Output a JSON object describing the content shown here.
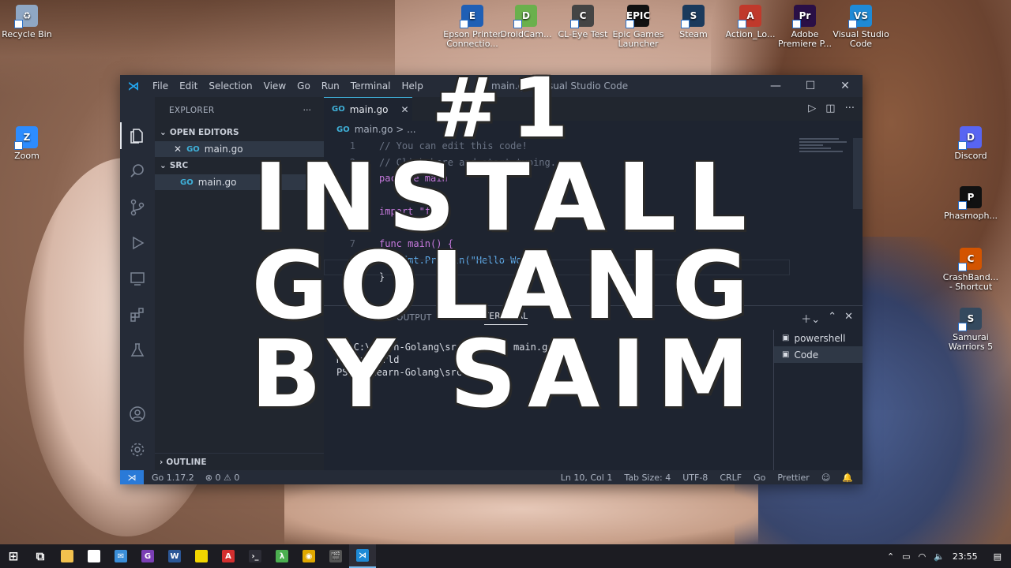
{
  "desktop": {
    "icons_top": [
      {
        "label": "Epson Printer Connectio...",
        "color": "#1f5fb5",
        "glyph": "E"
      },
      {
        "label": "DroidCam...",
        "color": "#6ab04c",
        "glyph": "D"
      },
      {
        "label": "CL-Eye Test",
        "color": "#444444",
        "glyph": "C"
      },
      {
        "label": "Epic Games Launcher",
        "color": "#111111",
        "glyph": "EPIC"
      },
      {
        "label": "Steam",
        "color": "#1b3a5c",
        "glyph": "S"
      },
      {
        "label": "Action_Lo...",
        "color": "#c0392b",
        "glyph": "A"
      },
      {
        "label": "Adobe Premiere P...",
        "color": "#2a0f46",
        "glyph": "Pr"
      },
      {
        "label": "Visual Studio Code",
        "color": "#1e8ad6",
        "glyph": "VS"
      }
    ],
    "icons_left": [
      {
        "label": "Recycle Bin",
        "color": "#8fa7c4",
        "glyph": "♻"
      },
      {
        "label": "Zoom",
        "color": "#2d8cff",
        "glyph": "Z"
      }
    ],
    "icons_right": [
      {
        "label": "Discord",
        "color": "#5865f2",
        "glyph": "D"
      },
      {
        "label": "Phasmoph...",
        "color": "#111111",
        "glyph": "P"
      },
      {
        "label": "CrashBand... - Shortcut",
        "color": "#d35400",
        "glyph": "C"
      },
      {
        "label": "Samurai Warriors 5",
        "color": "#34495e",
        "glyph": "S"
      }
    ]
  },
  "window": {
    "logo": "⋊",
    "menu": [
      "File",
      "Edit",
      "Selection",
      "View",
      "Go",
      "Run",
      "Terminal",
      "Help"
    ],
    "title": "main.go - Visual Studio Code",
    "minimize": "—",
    "maximize": "☐",
    "close": "✕"
  },
  "sidebar": {
    "header": "EXPLORER",
    "more": "···",
    "open_editors": "OPEN EDITORS",
    "open_file": "main.go",
    "folder": "SRC",
    "folder_file": "main.go",
    "outline": "OUTLINE"
  },
  "editor": {
    "tab": "main.go",
    "breadcrumb": "main.go > ...",
    "lines": [
      {
        "n": "1",
        "text": "// You can edit this code!",
        "cls": "c-com"
      },
      {
        "n": "2",
        "text": "// Click here and start typing.",
        "cls": "c-com"
      },
      {
        "n": "3",
        "text": "package main",
        "cls": "c-kw"
      },
      {
        "n": "4",
        "text": "",
        "cls": "c-id"
      },
      {
        "n": "5",
        "text": "import \"fmt\"",
        "cls": "c-kw"
      },
      {
        "n": "6",
        "text": "",
        "cls": "c-id"
      },
      {
        "n": "7",
        "text": "func main() {",
        "cls": "c-kw"
      },
      {
        "n": "8",
        "text": "    fmt.Println(\"Hello World\")",
        "cls": "c-fn"
      },
      {
        "n": "9",
        "text": "}",
        "cls": "c-id"
      },
      {
        "n": "10",
        "text": "",
        "cls": "c-id"
      }
    ]
  },
  "panel": {
    "tab_output": "OUTPUT",
    "tab_terminal": "TERMINAL",
    "terminal_lines": [
      "PS C:\\Learn-Golang\\src> go run main.go",
      "Hello World",
      "PS C:\\Learn-Golang\\src> "
    ],
    "terminals": [
      "powershell",
      "Code"
    ]
  },
  "statusbar": {
    "go_version": "Go 1.17.2",
    "problems": "⊗ 0 ⚠ 0",
    "position": "Ln 10, Col 1",
    "tab_size": "Tab Size: 4",
    "encoding": "UTF-8",
    "eol": "CRLF",
    "language": "Go",
    "prettier": "Prettier"
  },
  "overlay": {
    "line1": "#1",
    "line2": "INSTALL",
    "line3": "GOLANG",
    "line4": "BY SAIM"
  },
  "taskbar": {
    "apps": [
      {
        "name": "start",
        "color": "#ffffff",
        "glyph": "⊞"
      },
      {
        "name": "task-view",
        "color": "#ffffff",
        "glyph": "⧉"
      },
      {
        "name": "file-explorer",
        "color": "#f2c14e",
        "glyph": ""
      },
      {
        "name": "store",
        "color": "#ffffff",
        "glyph": "🛍"
      },
      {
        "name": "mail",
        "color": "#3b8ed8",
        "glyph": "✉"
      },
      {
        "name": "app-g",
        "color": "#7b3fb5",
        "glyph": "G"
      },
      {
        "name": "word",
        "color": "#2b5797",
        "glyph": "W"
      },
      {
        "name": "sticky-notes",
        "color": "#f2d600",
        "glyph": ""
      },
      {
        "name": "acrobat",
        "color": "#d32f2f",
        "glyph": "A"
      },
      {
        "name": "terminal",
        "color": "#2d2d36",
        "glyph": "›_"
      },
      {
        "name": "app-lambda",
        "color": "#4caf50",
        "glyph": "λ"
      },
      {
        "name": "chrome",
        "color": "#e0a800",
        "glyph": "◉"
      },
      {
        "name": "clapper",
        "color": "#555555",
        "glyph": "🎬"
      },
      {
        "name": "vscode",
        "color": "#1e8ad6",
        "glyph": "⋊"
      }
    ],
    "time": "23:55"
  }
}
